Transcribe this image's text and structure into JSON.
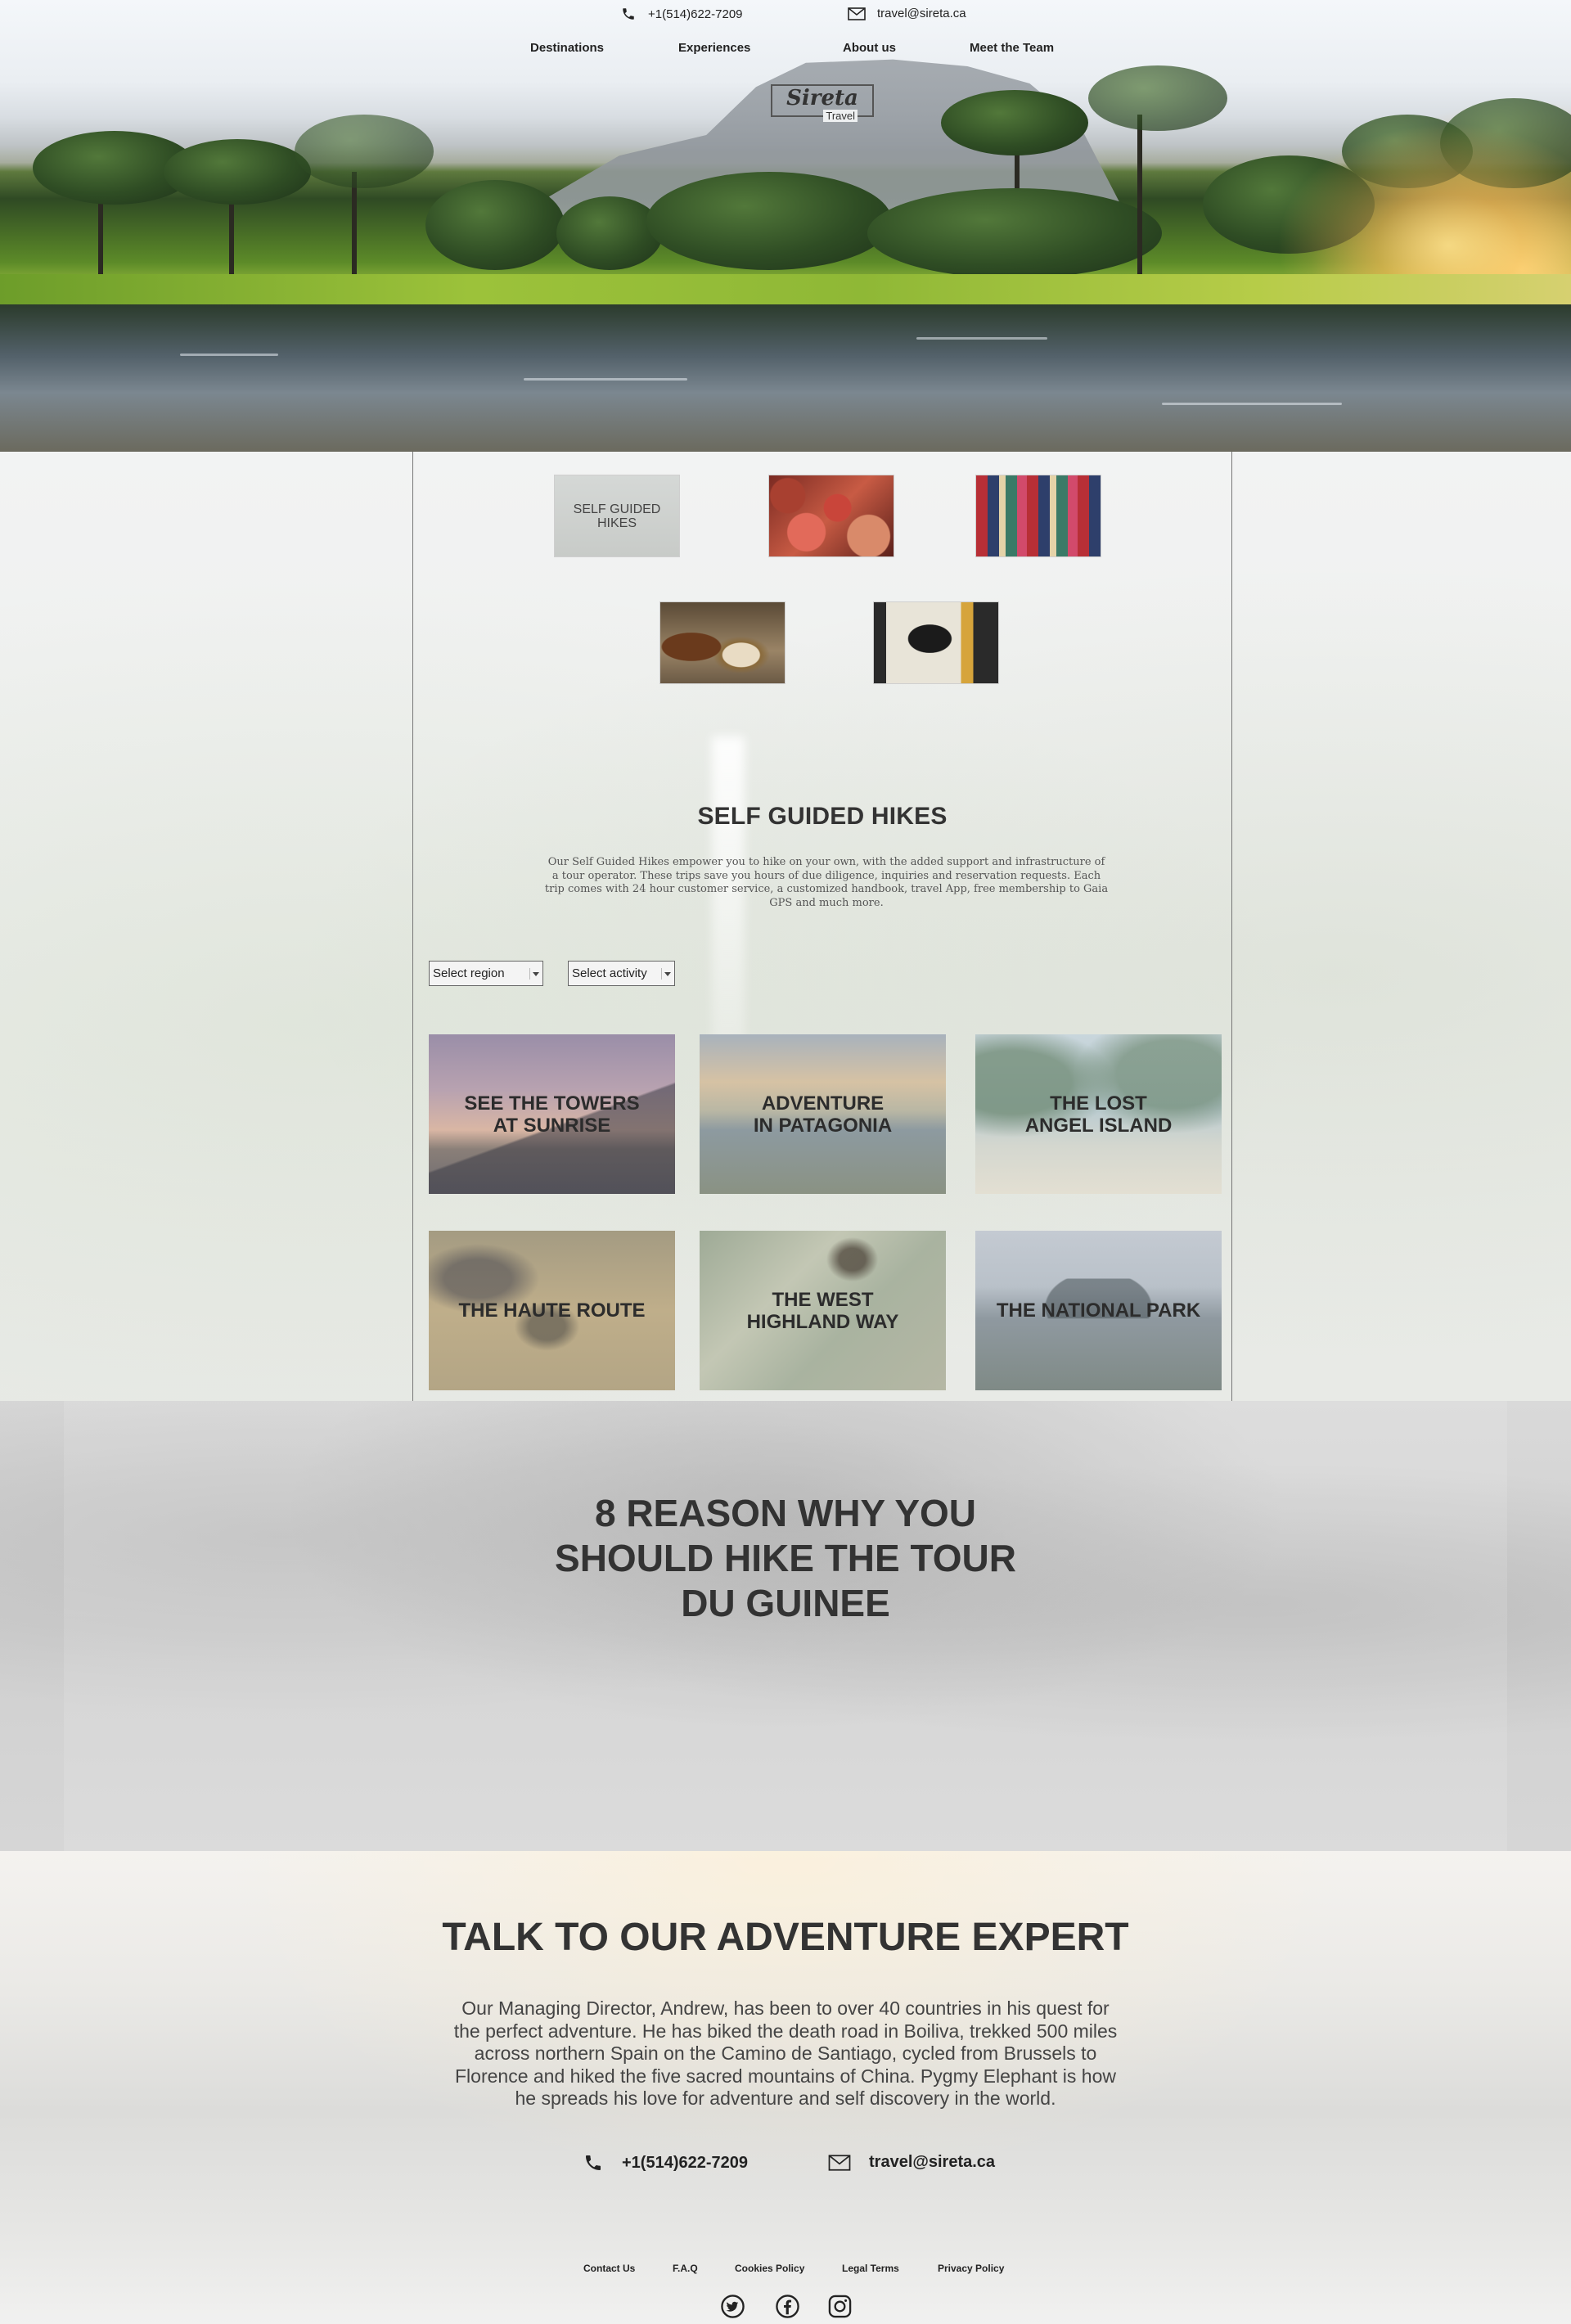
{
  "header": {
    "phone": "+1(514)622-7209",
    "email": "travel@sireta.ca",
    "nav": [
      "Destinations",
      "Experiences",
      "About us",
      "Meet the Team"
    ],
    "logo_script": "Sireta",
    "logo_sub": "Travel",
    "phone_icon": "phone-icon",
    "email_icon": "envelope-icon"
  },
  "thumbnails": [
    {
      "label": "SELF GUIDED HIKES",
      "image": "text-tile"
    },
    {
      "label": "",
      "image": "woven-baskets"
    },
    {
      "label": "",
      "image": "patterned-textile"
    },
    {
      "label": "",
      "image": "djembe-drum"
    },
    {
      "label": "",
      "image": "wood-carving"
    }
  ],
  "section": {
    "title": "SELF GUIDED HIKES",
    "description": "Our Self Guided Hikes empower you to hike on your own, with the added support and infrastructure of a tour operator. These trips save you hours of due diligence, inquiries and reservation requests. Each trip comes with 24 hour customer service, a customized handbook, travel App, free membership to Gaia GPS and much more."
  },
  "filters": {
    "region": "Select region",
    "activity": "Select activity"
  },
  "cards": [
    {
      "line1": "SEE THE TOWERS",
      "line2": "AT SUNRISE"
    },
    {
      "line1": "ADVENTURE",
      "line2": "IN PATAGONIA"
    },
    {
      "line1": "THE LOST",
      "line2": "ANGEL ISLAND"
    },
    {
      "line1": "THE HAUTE ROUTE",
      "line2": ""
    },
    {
      "line1": "THE WEST",
      "line2": "HIGHLAND WAY"
    },
    {
      "line1": "THE NATIONAL PARK",
      "line2": ""
    }
  ],
  "reasons": {
    "line1": "8 REASON WHY YOU",
    "line2": "SHOULD HIKE THE TOUR",
    "line3": "DU GUINEE"
  },
  "talk": {
    "title": "TALK TO OUR ADVENTURE EXPERT",
    "text": "Our Managing Director, Andrew, has been to over 40 countries in his quest for the perfect adventure. He has biked the death road in Boiliva, trekked 500 miles across northern Spain on the Camino de Santiago, cycled from Brussels to Florence and hiked the five sacred mountains of China. Pygmy Elephant is how he spreads his love for adventure and self discovery in the world.",
    "phone": "+1(514)622-7209",
    "email": "travel@sireta.ca"
  },
  "footer": {
    "links": [
      "Contact Us",
      "F.A.Q",
      "Cookies Policy",
      "Legal Terms",
      "Privacy Policy"
    ],
    "social": [
      "twitter-icon",
      "facebook-icon",
      "instagram-icon"
    ]
  }
}
